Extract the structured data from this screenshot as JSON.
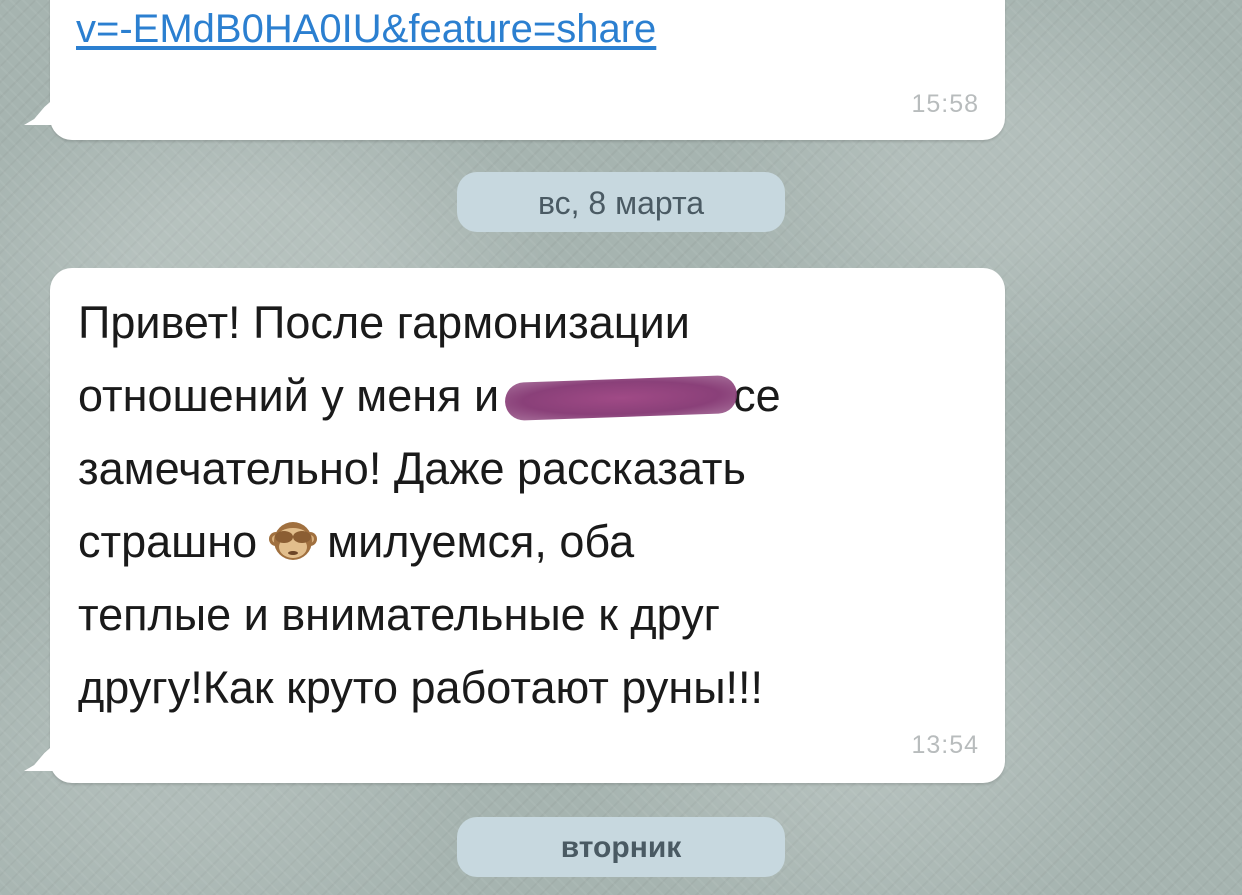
{
  "messages": [
    {
      "link": "v=-EMdB0HA0IU&feature=share",
      "time": "15:58"
    },
    {
      "lines": [
        "Привет! После гармонизации",
        "отношений у меня и",
        "се",
        "замечательно! Даже рассказать",
        "страшно",
        "милуемся, оба",
        "теплые и внимательные к друг",
        "другу!Как круто работают руны!!!"
      ],
      "emoji": "see-no-evil-monkey-icon",
      "time": "13:54"
    }
  ],
  "date_separators": [
    "вс, 8 марта",
    "вторник"
  ],
  "colors": {
    "link": "#2b7fd0",
    "redaction": "#8a4079",
    "date_pill": "#c7d8df",
    "background": "#a6b4b0"
  }
}
